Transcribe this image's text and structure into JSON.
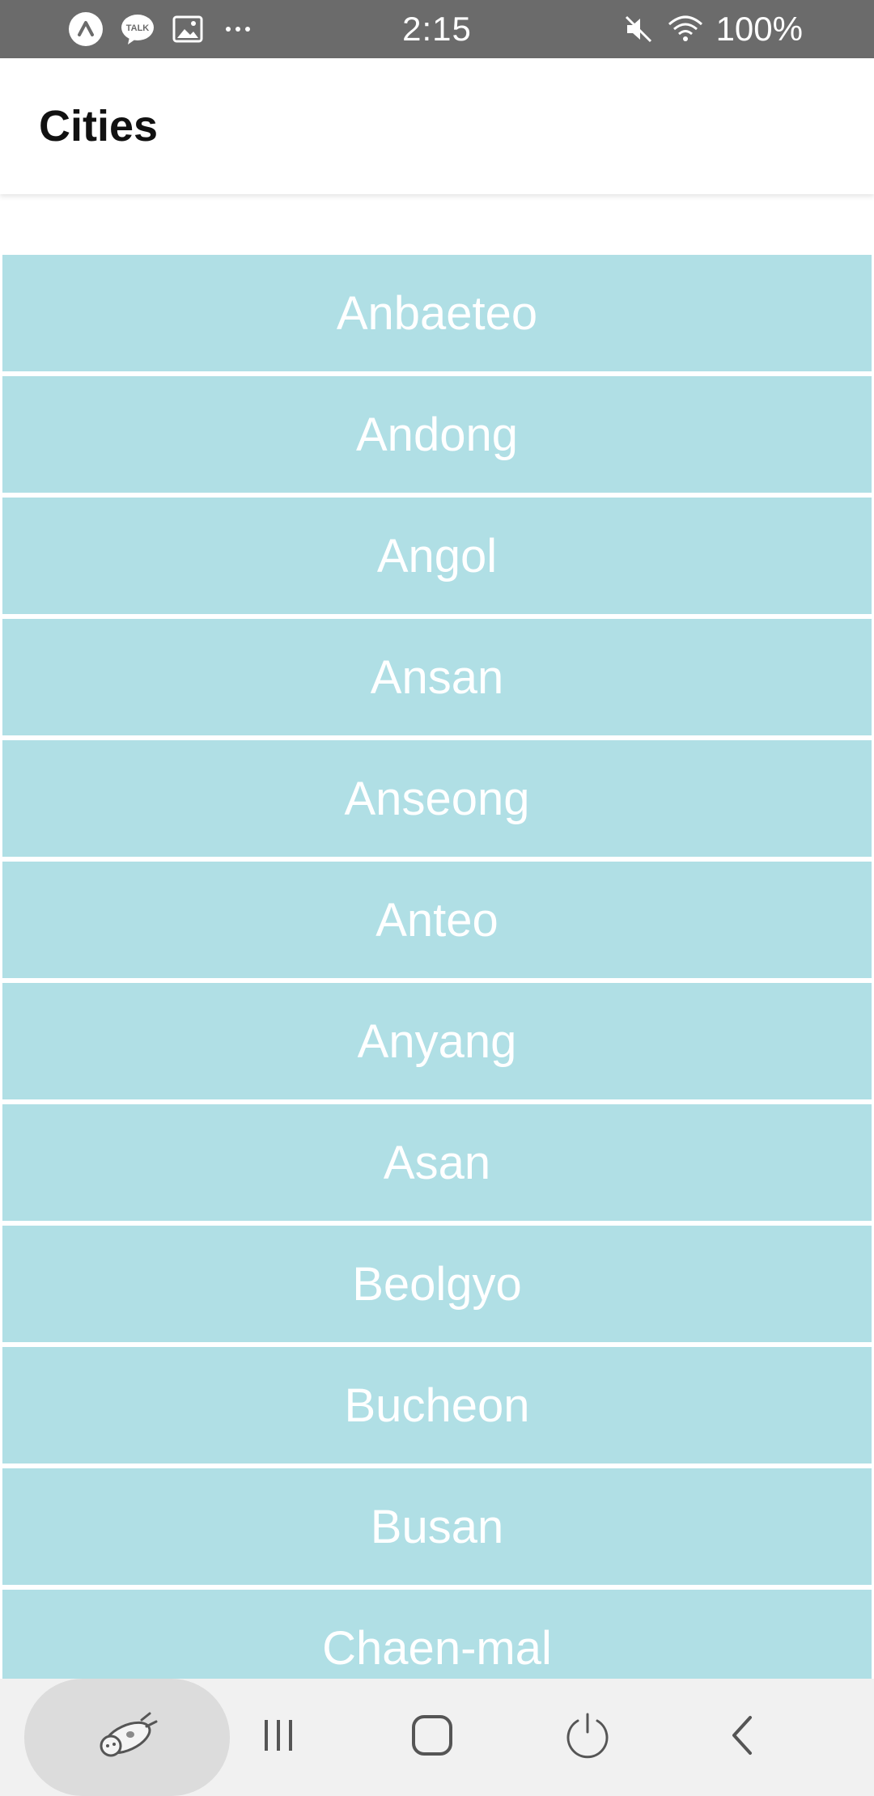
{
  "status_bar": {
    "time": "2:15",
    "battery": "100%",
    "left_icons": [
      "app-a-icon",
      "talk-icon",
      "gallery-icon",
      "more-icon"
    ],
    "right_icons": [
      "mute-icon",
      "wifi-icon"
    ],
    "talk_label": "TALK"
  },
  "app_bar": {
    "title": "Cities"
  },
  "cities": [
    "Anbaeteo",
    "Andong",
    "Angol",
    "Ansan",
    "Anseong",
    "Anteo",
    "Anyang",
    "Asan",
    "Beolgyo",
    "Bucheon",
    "Busan",
    "Chaen-mal"
  ],
  "colors": {
    "list_item_bg": "#b0dfe5",
    "list_item_text": "#ffffff",
    "status_bar_bg": "#6b6b6b",
    "nav_bar_bg": "#f1f1f1"
  },
  "nav_bar": {
    "buttons": [
      "pet-icon",
      "recent-apps-icon",
      "home-icon",
      "power-icon",
      "back-icon"
    ]
  }
}
